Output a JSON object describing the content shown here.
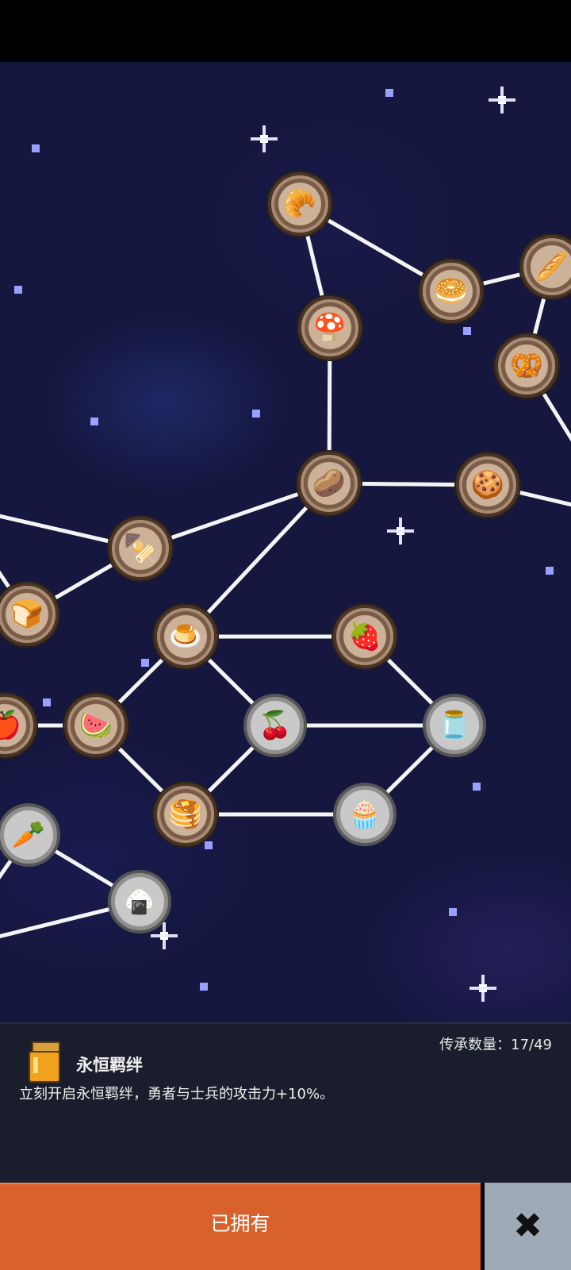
{
  "skill_tree": {
    "nodes": [
      {
        "id": "n1",
        "icon": "croissant-icon",
        "glyph": "🥐",
        "tier": "bronze"
      },
      {
        "id": "n2",
        "icon": "baguette-icon",
        "glyph": "🥖",
        "tier": "bronze"
      },
      {
        "id": "n3",
        "icon": "bread-roll-icon",
        "glyph": "🥯",
        "tier": "bronze"
      },
      {
        "id": "n4",
        "icon": "mushroom-icon",
        "glyph": "🍄",
        "tier": "bronze"
      },
      {
        "id": "n5",
        "icon": "churro-icon",
        "glyph": "🥨",
        "tier": "bronze"
      },
      {
        "id": "n6",
        "icon": "potato-icon",
        "glyph": "🥔",
        "tier": "bronze"
      },
      {
        "id": "n7",
        "icon": "cookie-icon",
        "glyph": "🍪",
        "tier": "bronze"
      },
      {
        "id": "n8",
        "icon": "skewer-icon",
        "glyph": "🍢",
        "tier": "bronze"
      },
      {
        "id": "n9",
        "icon": "bread-loaf-icon",
        "glyph": "🍞",
        "tier": "bronze"
      },
      {
        "id": "n10",
        "icon": "pudding-icon",
        "glyph": "🍮",
        "tier": "bronze"
      },
      {
        "id": "n11",
        "icon": "strawberry-icon",
        "glyph": "🍓",
        "tier": "bronze"
      },
      {
        "id": "n12",
        "icon": "apple-icon",
        "glyph": "🍎",
        "tier": "bronze"
      },
      {
        "id": "n13",
        "icon": "watermelon-icon",
        "glyph": "🍉",
        "tier": "bronze"
      },
      {
        "id": "n14",
        "icon": "cherries-icon",
        "glyph": "🍒",
        "tier": "silver"
      },
      {
        "id": "n15",
        "icon": "jam-jar-icon",
        "glyph": "🫙",
        "tier": "silver"
      },
      {
        "id": "n16",
        "icon": "pancakes-icon",
        "glyph": "🥞",
        "tier": "bronze"
      },
      {
        "id": "n17",
        "icon": "cupcake-icon",
        "glyph": "🧁",
        "tier": "silver"
      },
      {
        "id": "n18",
        "icon": "radish-icon",
        "glyph": "🥕",
        "tier": "silver"
      },
      {
        "id": "n19",
        "icon": "onigiri-icon",
        "glyph": "🍙",
        "tier": "silver"
      }
    ]
  },
  "info_panel": {
    "item_icon": "honey-jar-icon",
    "title": "永恒羁绊",
    "count_label": "传承数量：17/49",
    "description": "立刻开启永恒羁绊，勇者与士兵的攻击力+10%。"
  },
  "actions": {
    "owned_label": "已拥有",
    "close_icon": "close-icon",
    "close_glyph": "✖"
  },
  "colors": {
    "owned_button": "#d9612b",
    "close_button": "#9eabb7",
    "panel_bg": "#1a1e2c",
    "sky": "#15173f"
  }
}
